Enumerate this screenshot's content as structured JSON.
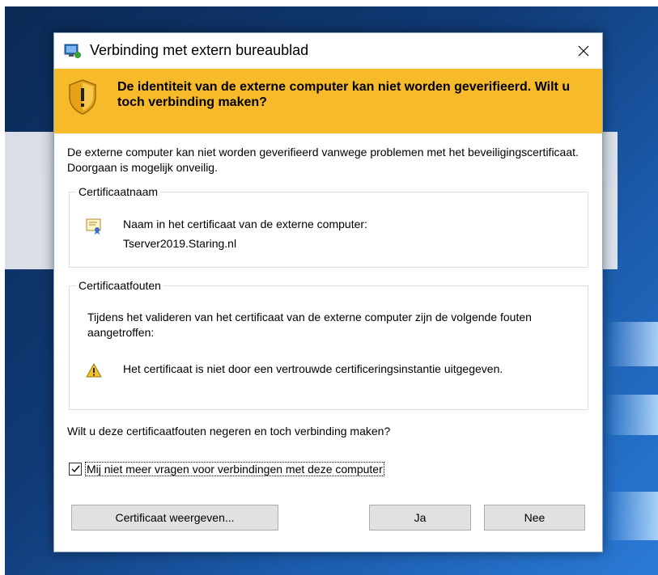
{
  "window": {
    "title": "Verbinding met extern bureaublad",
    "app_icon": "remote-desktop-icon",
    "close_icon": "close-icon"
  },
  "banner": {
    "text": "De identiteit van de externe computer kan niet worden geverifieerd. Wilt u toch verbinding maken?",
    "icon": "shield-warning-icon",
    "color": "#f6ba2b"
  },
  "intro_text": "De externe computer kan niet worden geverifieerd vanwege problemen met het beveiligingscertificaat. Doorgaan is mogelijk onveilig.",
  "certificate_name": {
    "legend": "Certificaatnaam",
    "label": "Naam in het certificaat van de externe computer:",
    "value": "Tserver2019.Staring.nl",
    "icon": "certificate-icon"
  },
  "certificate_errors": {
    "legend": "Certificaatfouten",
    "description": "Tijdens het valideren van het certificaat van de externe computer zijn de volgende fouten aangetroffen:",
    "items": [
      {
        "icon": "warning-icon",
        "text": "Het certificaat is niet door een vertrouwde certificeringsinstantie uitgegeven."
      }
    ]
  },
  "question": "Wilt u deze certificaatfouten negeren en toch verbinding maken?",
  "dont_ask_checkbox": {
    "label": "Mij niet meer vragen voor verbindingen met deze computer",
    "checked": true
  },
  "buttons": {
    "view_certificate": "Certificaat weergeven...",
    "yes": "Ja",
    "no": "Nee"
  }
}
